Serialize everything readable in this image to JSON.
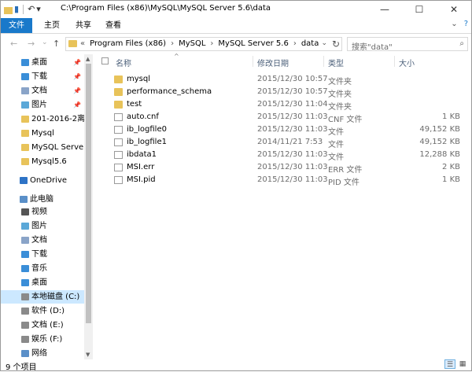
{
  "window": {
    "title": "C:\\Program Files (x86)\\MySQL\\MySQL Server 5.6\\data",
    "buttons": {
      "minimize": "—",
      "maximize": "☐",
      "close": "✕"
    },
    "quick_access": {
      "save": "▮",
      "undo": "↶",
      "customize": "▾"
    }
  },
  "ribbon": {
    "tabs": [
      "文件",
      "主页",
      "共享",
      "查看"
    ],
    "collapse": "⌄",
    "help": "?"
  },
  "nav": {
    "back": "←",
    "forward": "→",
    "recent": "⌄",
    "up": "↑"
  },
  "address": {
    "crumbs": [
      "«",
      "Program Files (x86)",
      "›",
      "MySQL",
      "›",
      "MySQL Server 5.6",
      "›",
      "data"
    ],
    "dropdown": "⌄",
    "refresh": "↻"
  },
  "search": {
    "placeholder": "搜索\"data\"",
    "icon": "⌕"
  },
  "sidebar": {
    "items": [
      {
        "label": "桌面",
        "pinned": true,
        "icon": "desktop-icon",
        "color": "#3a8ed8"
      },
      {
        "label": "下载",
        "pinned": true,
        "icon": "download-icon",
        "color": "#3a8ed8"
      },
      {
        "label": "文档",
        "pinned": true,
        "icon": "document-icon",
        "color": "#8aa4c8"
      },
      {
        "label": "图片",
        "pinned": true,
        "icon": "picture-icon",
        "color": "#5ba8d8"
      },
      {
        "label": "201-2016-2离散",
        "pinned": false,
        "icon": "folder-icon",
        "color": "#e8c35a"
      },
      {
        "label": "Mysql",
        "pinned": false,
        "icon": "folder-icon",
        "color": "#e8c35a"
      },
      {
        "label": "MySQL Server",
        "pinned": false,
        "icon": "folder-icon",
        "color": "#e8c35a"
      },
      {
        "label": "Mysql5.6",
        "pinned": false,
        "icon": "folder-icon",
        "color": "#e8c35a"
      },
      {
        "label": "OneDrive",
        "pinned": false,
        "icon": "cloud-icon",
        "color": "#2e73c6"
      },
      {
        "label": "此电脑",
        "pinned": false,
        "icon": "computer-icon",
        "color": "#5a8fc8"
      },
      {
        "label": "视频",
        "pinned": false,
        "icon": "video-icon",
        "color": "#555555"
      },
      {
        "label": "图片",
        "pinned": false,
        "icon": "picture-icon",
        "color": "#5ba8d8"
      },
      {
        "label": "文档",
        "pinned": false,
        "icon": "document-icon",
        "color": "#8aa4c8"
      },
      {
        "label": "下载",
        "pinned": false,
        "icon": "download-icon",
        "color": "#3a8ed8"
      },
      {
        "label": "音乐",
        "pinned": false,
        "icon": "music-icon",
        "color": "#3a8ed8"
      },
      {
        "label": "桌面",
        "pinned": false,
        "icon": "desktop-icon",
        "color": "#3a8ed8"
      },
      {
        "label": "本地磁盘 (C:)",
        "pinned": false,
        "icon": "drive-icon",
        "color": "#8a8a8a",
        "selected": true
      },
      {
        "label": "软件 (D:)",
        "pinned": false,
        "icon": "drive-icon",
        "color": "#8a8a8a"
      },
      {
        "label": "文档 (E:)",
        "pinned": false,
        "icon": "drive-icon",
        "color": "#8a8a8a"
      },
      {
        "label": "娱乐 (F:)",
        "pinned": false,
        "icon": "drive-icon",
        "color": "#8a8a8a"
      },
      {
        "label": "网络",
        "pinned": false,
        "icon": "network-icon",
        "color": "#5a8fc8"
      }
    ]
  },
  "columns": {
    "name": "名称",
    "modified": "修改日期",
    "type": "类型",
    "size": "大小"
  },
  "files": [
    {
      "name": "mysql",
      "date": "2015/12/30 10:57",
      "type": "文件夹",
      "size": "",
      "kind": "folder"
    },
    {
      "name": "performance_schema",
      "date": "2015/12/30 10:57",
      "type": "文件夹",
      "size": "",
      "kind": "folder"
    },
    {
      "name": "test",
      "date": "2015/12/30 11:04",
      "type": "文件夹",
      "size": "",
      "kind": "folder"
    },
    {
      "name": "auto.cnf",
      "date": "2015/12/30 11:03",
      "type": "CNF 文件",
      "size": "1 KB",
      "kind": "file"
    },
    {
      "name": "ib_logfile0",
      "date": "2015/12/30 11:03",
      "type": "文件",
      "size": "49,152 KB",
      "kind": "file"
    },
    {
      "name": "ib_logfile1",
      "date": "2014/11/21 7:53",
      "type": "文件",
      "size": "49,152 KB",
      "kind": "file"
    },
    {
      "name": "ibdata1",
      "date": "2015/12/30 11:03",
      "type": "文件",
      "size": "12,288 KB",
      "kind": "file"
    },
    {
      "name": "MSI.err",
      "date": "2015/12/30 11:03",
      "type": "ERR 文件",
      "size": "2 KB",
      "kind": "file"
    },
    {
      "name": "MSI.pid",
      "date": "2015/12/30 11:03",
      "type": "PID 文件",
      "size": "1 KB",
      "kind": "file"
    }
  ],
  "status": {
    "count": "9 个项目"
  },
  "colors": {
    "accent": "#1979ca",
    "selected": "#cce8ff",
    "folder": "#e8c35a"
  }
}
